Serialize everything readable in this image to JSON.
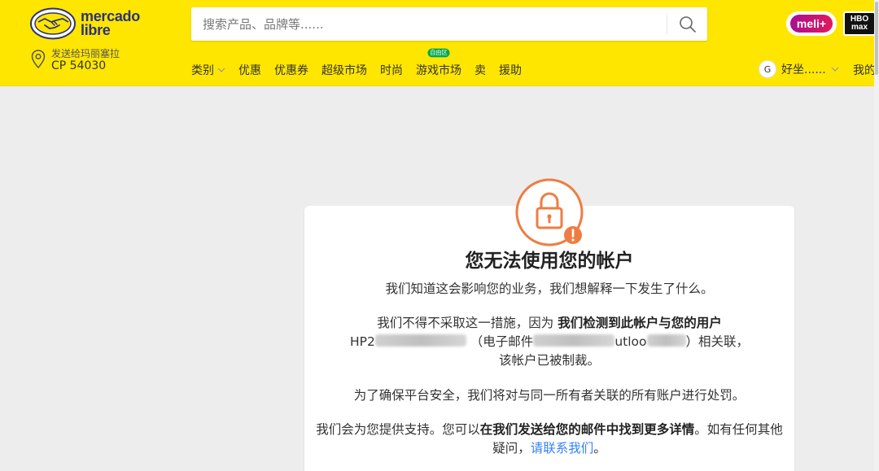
{
  "header": {
    "logo": {
      "line1": "mercado",
      "line2": "libre"
    },
    "search": {
      "placeholder": "搜索产品、品牌等......",
      "value": ""
    },
    "promo_meli": "meli+",
    "promo_hbo": {
      "line1": "HBO",
      "line2": "max"
    },
    "address": {
      "line1": "发送给玛丽塞拉",
      "line2": "CP 54030"
    },
    "nav": [
      {
        "label": "类别"
      },
      {
        "label": "优惠"
      },
      {
        "label": "优惠券"
      },
      {
        "label": "超级市场"
      },
      {
        "label": "时尚"
      },
      {
        "label": "游戏市场",
        "badge": "自由区"
      },
      {
        "label": "卖"
      },
      {
        "label": "援助"
      }
    ],
    "account": {
      "avatar_letter": "G",
      "name": "好坐......"
    },
    "nav_right": "我的"
  },
  "card": {
    "title": "您无法使用您的帐户",
    "p1": "我们知道这会影响您的业务，我们想解释一下发生了什么。",
    "p2": {
      "a": "我们不得不采取这一措施，因为 ",
      "b": "我们检测到此帐户与您的用户",
      "c": "HP2",
      "d": "（电子邮件",
      "e": "utloo",
      "f": "）相关联，",
      "g": "该帐户已被制裁。"
    },
    "p3": "为了确保平台安全，我们将对与同一所有者关联的所有账户进行处罚。",
    "p4": {
      "a": "我们会为您提供支持。您可以",
      "b": "在我们发送给您的邮件中找到更多详情",
      "c": "。如有任何其他疑问，",
      "d": "请联系我们",
      "e": "。"
    }
  },
  "colors": {
    "brand_yellow": "#ffe600",
    "brand_blue": "#2d3277",
    "lock_orange": "#ee7d43",
    "link_blue": "#3483fa"
  },
  "icons": [
    "handshake-logo-icon",
    "search-icon",
    "location-pin-icon",
    "chevron-down-icon",
    "lock-icon",
    "warning-icon"
  ]
}
